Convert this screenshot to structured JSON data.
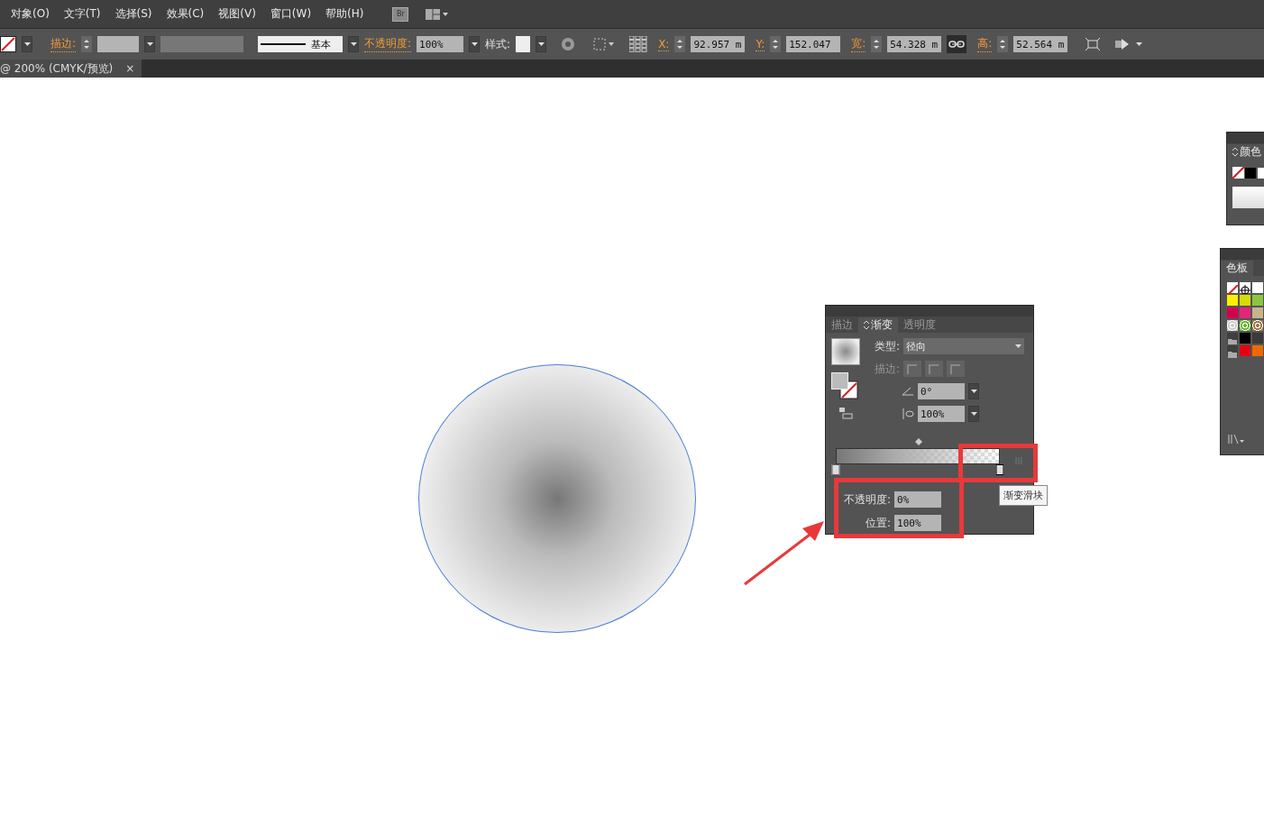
{
  "menu": [
    "对象(O)",
    "文字(T)",
    "选择(S)",
    "效果(C)",
    "视图(V)",
    "窗口(W)",
    "帮助(H)"
  ],
  "menu_icon_label": "Br",
  "control_bar": {
    "stroke_label": "描边:",
    "stroke_style": "基本",
    "opacity_label": "不透明度:",
    "opacity_value": "100%",
    "style_label": "样式:",
    "fields": [
      {
        "label": "X:",
        "value": "92.957 m"
      },
      {
        "label": "Y:",
        "value": "152.047"
      },
      {
        "label": "宽:",
        "value": "54.328 m"
      },
      {
        "label": "高:",
        "value": "52.564 m"
      }
    ]
  },
  "document_tab": {
    "title": "@ 200% (CMYK/预览)",
    "close": "×"
  },
  "gradient_panel": {
    "tabs": [
      {
        "label": "描边",
        "selected": false
      },
      {
        "label": "渐变",
        "selected": true
      },
      {
        "label": "透明度",
        "selected": false
      }
    ],
    "type_label": "类型:",
    "type_value": "径向",
    "stroke_label": "描边:",
    "angle_value": "0°",
    "aspect_value": "100%",
    "stops": [
      {
        "selected": false,
        "level": 0
      },
      {
        "selected": true,
        "level": 1
      }
    ],
    "opacity_label": "不透明度:",
    "opacity_value": "0%",
    "location_label": "位置:",
    "location_value": "100%",
    "tooltip": "渐变滑块"
  },
  "color_panel": {
    "title": "颜色"
  },
  "swatches_panel": {
    "title": "色板",
    "swatches": [
      {
        "kind": "none",
        "color": "#ffffff"
      },
      {
        "kind": "registration",
        "color": "#ffffff"
      },
      {
        "kind": "plain",
        "color": "#ffffff"
      },
      {
        "kind": "plain",
        "color": "#ffee00"
      },
      {
        "kind": "plain",
        "color": "#d8dc00"
      },
      {
        "kind": "plain",
        "color": "#8cc63f"
      },
      {
        "kind": "plain",
        "color": "#d4004f"
      },
      {
        "kind": "plain",
        "color": "#e6267a"
      },
      {
        "kind": "plain",
        "color": "#c8b48c"
      },
      {
        "kind": "pattern",
        "color": "#cccccc"
      },
      {
        "kind": "pattern",
        "color": "#6ab82e"
      },
      {
        "kind": "pattern",
        "color": "#a0784a"
      },
      {
        "kind": "folder",
        "color": "#aaaaaa"
      },
      {
        "kind": "plain",
        "color": "#000000"
      },
      {
        "kind": "plain",
        "color": "#3a3a3a"
      },
      {
        "kind": "folder",
        "color": "#aaaaaa"
      },
      {
        "kind": "plain",
        "color": "#e60012"
      },
      {
        "kind": "plain",
        "color": "#ee6a00"
      }
    ]
  }
}
